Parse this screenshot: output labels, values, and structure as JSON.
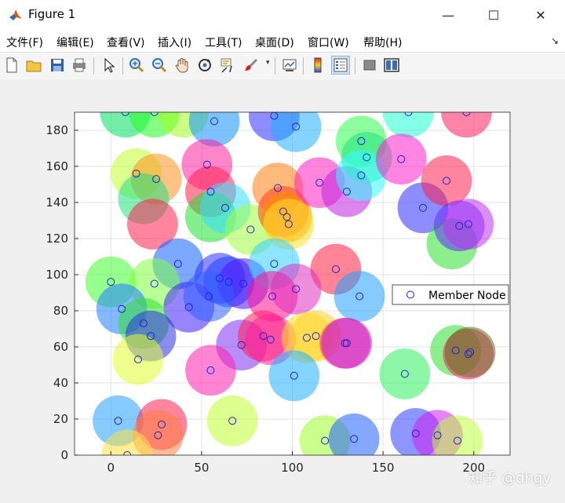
{
  "window": {
    "title": "Figure 1",
    "minimize_glyph": "—",
    "maximize_glyph": "☐",
    "close_glyph": "✕"
  },
  "menubar": {
    "items": [
      "文件(F)",
      "编辑(E)",
      "查看(V)",
      "插入(I)",
      "工具(T)",
      "桌面(D)",
      "窗口(W)",
      "帮助(H)"
    ],
    "corner_glyph": "↘"
  },
  "toolbar": {
    "icons": [
      "new-figure-icon",
      "open-file-icon",
      "save-icon",
      "print-icon",
      "pointer-icon",
      "zoom-in-icon",
      "zoom-out-icon",
      "pan-hand-icon",
      "rotate-3d-icon",
      "data-cursor-icon",
      "brush-icon",
      "link-plot-icon",
      "colorbar-icon",
      "legend-icon",
      "hide-plot-tools-icon",
      "show-plot-tools-icon"
    ]
  },
  "watermark": "知乎 @dhgy",
  "chart_data": {
    "type": "scatter",
    "title": "",
    "xlabel": "",
    "ylabel": "",
    "xlim": [
      -20,
      220
    ],
    "ylim": [
      0,
      190
    ],
    "xticks": [
      0,
      50,
      100,
      150,
      200
    ],
    "yticks": [
      0,
      20,
      40,
      60,
      80,
      100,
      120,
      140,
      160,
      180
    ],
    "grid": true,
    "legend": {
      "entries": [
        "Member Node"
      ],
      "placement": "right"
    },
    "series": [
      {
        "name": "Member Node",
        "marker_color": "#1f1fcf",
        "points": [
          [
            8,
            190
          ],
          [
            24,
            190
          ],
          [
            57,
            185
          ],
          [
            90,
            188
          ],
          [
            102,
            182
          ],
          [
            164,
            190
          ],
          [
            196,
            190
          ],
          [
            14,
            156
          ],
          [
            25,
            153
          ],
          [
            53,
            161
          ],
          [
            55,
            146
          ],
          [
            63,
            137
          ],
          [
            77,
            125
          ],
          [
            92,
            148
          ],
          [
            95,
            135
          ],
          [
            97,
            132
          ],
          [
            98,
            128
          ],
          [
            115,
            151
          ],
          [
            130,
            146
          ],
          [
            138,
            174
          ],
          [
            141,
            165
          ],
          [
            138,
            155
          ],
          [
            160,
            164
          ],
          [
            172,
            137
          ],
          [
            185,
            152
          ],
          [
            192,
            127
          ],
          [
            197,
            128
          ],
          [
            0,
            96
          ],
          [
            37,
            106
          ],
          [
            24,
            95
          ],
          [
            60,
            98
          ],
          [
            65,
            96
          ],
          [
            73,
            95
          ],
          [
            90,
            106
          ],
          [
            124,
            103
          ],
          [
            137,
            88
          ],
          [
            6,
            81
          ],
          [
            43,
            82
          ],
          [
            18,
            73
          ],
          [
            22,
            66
          ],
          [
            54,
            88
          ],
          [
            89,
            88
          ],
          [
            102,
            92
          ],
          [
            72,
            61
          ],
          [
            84,
            66
          ],
          [
            88,
            64
          ],
          [
            108,
            65
          ],
          [
            113,
            66
          ],
          [
            129,
            62
          ],
          [
            130,
            62
          ],
          [
            15,
            53
          ],
          [
            55,
            47
          ],
          [
            101,
            44
          ],
          [
            162,
            45
          ],
          [
            190,
            58
          ],
          [
            197,
            56
          ],
          [
            198,
            57
          ],
          [
            4,
            19
          ],
          [
            28,
            17
          ],
          [
            26,
            11
          ],
          [
            67,
            19
          ],
          [
            118,
            8
          ],
          [
            134,
            9
          ],
          [
            168,
            12
          ],
          [
            180,
            11
          ],
          [
            191,
            8
          ],
          [
            9,
            0
          ]
        ]
      }
    ],
    "coverage_circles": [
      {
        "x": 8,
        "y": 190,
        "color": "#00e060"
      },
      {
        "x": 24,
        "y": 190,
        "color": "#20ff20"
      },
      {
        "x": 40,
        "y": 190,
        "color": "#a0ff20"
      },
      {
        "x": 57,
        "y": 185,
        "color": "#1090ff"
      },
      {
        "x": 90,
        "y": 188,
        "color": "#3030ff"
      },
      {
        "x": 102,
        "y": 182,
        "color": "#20b0ff"
      },
      {
        "x": 164,
        "y": 190,
        "color": "#20ffd0"
      },
      {
        "x": 196,
        "y": 190,
        "color": "#ff2060"
      },
      {
        "x": 14,
        "y": 156,
        "color": "#c0ff30"
      },
      {
        "x": 25,
        "y": 153,
        "color": "#ff9020"
      },
      {
        "x": 18,
        "y": 142,
        "color": "#20e080"
      },
      {
        "x": 23,
        "y": 128,
        "color": "#ff2050"
      },
      {
        "x": 53,
        "y": 161,
        "color": "#ff20a0"
      },
      {
        "x": 55,
        "y": 146,
        "color": "#ff2050"
      },
      {
        "x": 55,
        "y": 132,
        "color": "#20e030"
      },
      {
        "x": 63,
        "y": 137,
        "color": "#30e0ff"
      },
      {
        "x": 77,
        "y": 125,
        "color": "#a0ff40"
      },
      {
        "x": 92,
        "y": 148,
        "color": "#ff8010"
      },
      {
        "x": 95,
        "y": 135,
        "color": "#ff4020"
      },
      {
        "x": 97,
        "y": 132,
        "color": "#ff9000"
      },
      {
        "x": 98,
        "y": 128,
        "color": "#ffe020"
      },
      {
        "x": 115,
        "y": 151,
        "color": "#ff20c0"
      },
      {
        "x": 130,
        "y": 146,
        "color": "#c020e0"
      },
      {
        "x": 138,
        "y": 174,
        "color": "#30ff50"
      },
      {
        "x": 141,
        "y": 165,
        "color": "#20e080"
      },
      {
        "x": 138,
        "y": 155,
        "color": "#30ffff"
      },
      {
        "x": 160,
        "y": 164,
        "color": "#ff20d0"
      },
      {
        "x": 172,
        "y": 137,
        "color": "#3030ff"
      },
      {
        "x": 185,
        "y": 152,
        "color": "#ff2050"
      },
      {
        "x": 188,
        "y": 117,
        "color": "#30e030"
      },
      {
        "x": 192,
        "y": 127,
        "color": "#6030ff"
      },
      {
        "x": 197,
        "y": 128,
        "color": "#c030f0"
      },
      {
        "x": 0,
        "y": 96,
        "color": "#40ff30"
      },
      {
        "x": 37,
        "y": 106,
        "color": "#1060ff"
      },
      {
        "x": 24,
        "y": 95,
        "color": "#80ff40"
      },
      {
        "x": 60,
        "y": 98,
        "color": "#3030ff"
      },
      {
        "x": 65,
        "y": 96,
        "color": "#2040ff"
      },
      {
        "x": 73,
        "y": 95,
        "color": "#5010ff"
      },
      {
        "x": 90,
        "y": 106,
        "color": "#30d0ff"
      },
      {
        "x": 124,
        "y": 103,
        "color": "#ff2040"
      },
      {
        "x": 137,
        "y": 88,
        "color": "#20a0ff"
      },
      {
        "x": 6,
        "y": 81,
        "color": "#2080ff"
      },
      {
        "x": 43,
        "y": 82,
        "color": "#4020ff"
      },
      {
        "x": 18,
        "y": 73,
        "color": "#30e030"
      },
      {
        "x": 22,
        "y": 66,
        "color": "#3030e0"
      },
      {
        "x": 54,
        "y": 88,
        "color": "#3060ff"
      },
      {
        "x": 89,
        "y": 88,
        "color": "#ff1090"
      },
      {
        "x": 102,
        "y": 92,
        "color": "#e030c0"
      },
      {
        "x": 72,
        "y": 61,
        "color": "#8030f0"
      },
      {
        "x": 84,
        "y": 66,
        "color": "#ff2060"
      },
      {
        "x": 88,
        "y": 64,
        "color": "#ff20a0"
      },
      {
        "x": 108,
        "y": 65,
        "color": "#ffe020"
      },
      {
        "x": 113,
        "y": 66,
        "color": "#ffd020"
      },
      {
        "x": 129,
        "y": 62,
        "color": "#ff2060"
      },
      {
        "x": 130,
        "y": 62,
        "color": "#c020e0"
      },
      {
        "x": 15,
        "y": 53,
        "color": "#e0ff30"
      },
      {
        "x": 55,
        "y": 47,
        "color": "#ff20b0"
      },
      {
        "x": 101,
        "y": 44,
        "color": "#20b0ff"
      },
      {
        "x": 162,
        "y": 45,
        "color": "#30f060"
      },
      {
        "x": 190,
        "y": 58,
        "color": "#30e030"
      },
      {
        "x": 197,
        "y": 56,
        "color": "#ff2060"
      },
      {
        "x": 198,
        "y": 57,
        "color": "#607020"
      },
      {
        "x": 4,
        "y": 19,
        "color": "#20a0ff"
      },
      {
        "x": 28,
        "y": 17,
        "color": "#ff2050"
      },
      {
        "x": 26,
        "y": 11,
        "color": "#ff8040"
      },
      {
        "x": 67,
        "y": 19,
        "color": "#c0ff30"
      },
      {
        "x": 118,
        "y": 8,
        "color": "#a0ff30"
      },
      {
        "x": 134,
        "y": 9,
        "color": "#2060ff"
      },
      {
        "x": 168,
        "y": 12,
        "color": "#3040ff"
      },
      {
        "x": 180,
        "y": 11,
        "color": "#d020f0"
      },
      {
        "x": 191,
        "y": 8,
        "color": "#c0ff40"
      },
      {
        "x": 9,
        "y": 0,
        "color": "#ffe040"
      }
    ],
    "coverage_radius": 14,
    "coverage_opacity": 0.55
  }
}
